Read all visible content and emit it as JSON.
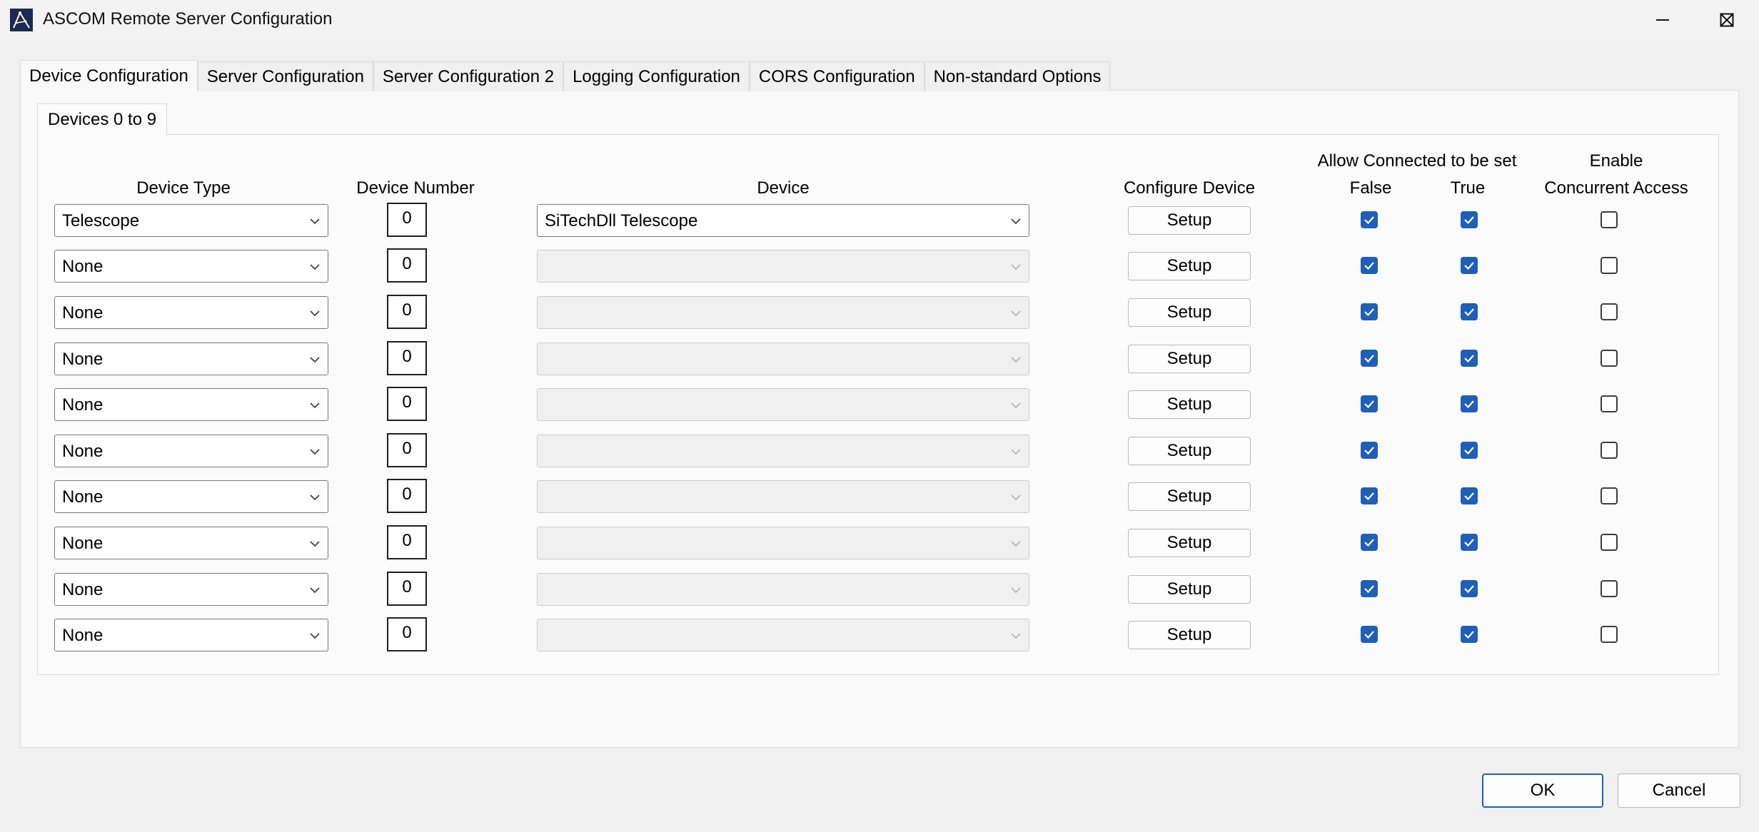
{
  "window": {
    "title": "ASCOM Remote Server Configuration"
  },
  "tabs": [
    "Device Configuration",
    "Server Configuration",
    "Server Configuration 2",
    "Logging Configuration",
    "CORS Configuration",
    "Non-standard Options"
  ],
  "inner_tab": "Devices 0 to 9",
  "headers": {
    "device_type": "Device Type",
    "device_number": "Device Number",
    "device": "Device",
    "configure_device": "Configure Device",
    "allow_connected": "Allow Connected to be set",
    "false": "False",
    "true": "True",
    "enable": "Enable",
    "concurrent_access": "Concurrent Access"
  },
  "rows": [
    {
      "device_type": "Telescope",
      "device_number": "0",
      "device": "SiTechDll Telescope",
      "device_enabled": true,
      "setup": "Setup",
      "allow_false": true,
      "allow_true": true,
      "concurrent": false
    },
    {
      "device_type": "None",
      "device_number": "0",
      "device": "",
      "device_enabled": false,
      "setup": "Setup",
      "allow_false": true,
      "allow_true": true,
      "concurrent": false
    },
    {
      "device_type": "None",
      "device_number": "0",
      "device": "",
      "device_enabled": false,
      "setup": "Setup",
      "allow_false": true,
      "allow_true": true,
      "concurrent": false
    },
    {
      "device_type": "None",
      "device_number": "0",
      "device": "",
      "device_enabled": false,
      "setup": "Setup",
      "allow_false": true,
      "allow_true": true,
      "concurrent": false
    },
    {
      "device_type": "None",
      "device_number": "0",
      "device": "",
      "device_enabled": false,
      "setup": "Setup",
      "allow_false": true,
      "allow_true": true,
      "concurrent": false
    },
    {
      "device_type": "None",
      "device_number": "0",
      "device": "",
      "device_enabled": false,
      "setup": "Setup",
      "allow_false": true,
      "allow_true": true,
      "concurrent": false
    },
    {
      "device_type": "None",
      "device_number": "0",
      "device": "",
      "device_enabled": false,
      "setup": "Setup",
      "allow_false": true,
      "allow_true": true,
      "concurrent": false
    },
    {
      "device_type": "None",
      "device_number": "0",
      "device": "",
      "device_enabled": false,
      "setup": "Setup",
      "allow_false": true,
      "allow_true": true,
      "concurrent": false
    },
    {
      "device_type": "None",
      "device_number": "0",
      "device": "",
      "device_enabled": false,
      "setup": "Setup",
      "allow_false": true,
      "allow_true": true,
      "concurrent": false
    },
    {
      "device_type": "None",
      "device_number": "0",
      "device": "",
      "device_enabled": false,
      "setup": "Setup",
      "allow_false": true,
      "allow_true": true,
      "concurrent": false
    }
  ],
  "buttons": {
    "ok": "OK",
    "cancel": "Cancel"
  },
  "colors": {
    "accent": "#1f5fb8",
    "window_bg": "#f0f0f0"
  },
  "icons": {
    "app": "ascom-icon",
    "minimize": "minimize-icon",
    "maximize": "maximize-icon",
    "close": "close-icon",
    "dropdown": "chevron-down-icon"
  }
}
